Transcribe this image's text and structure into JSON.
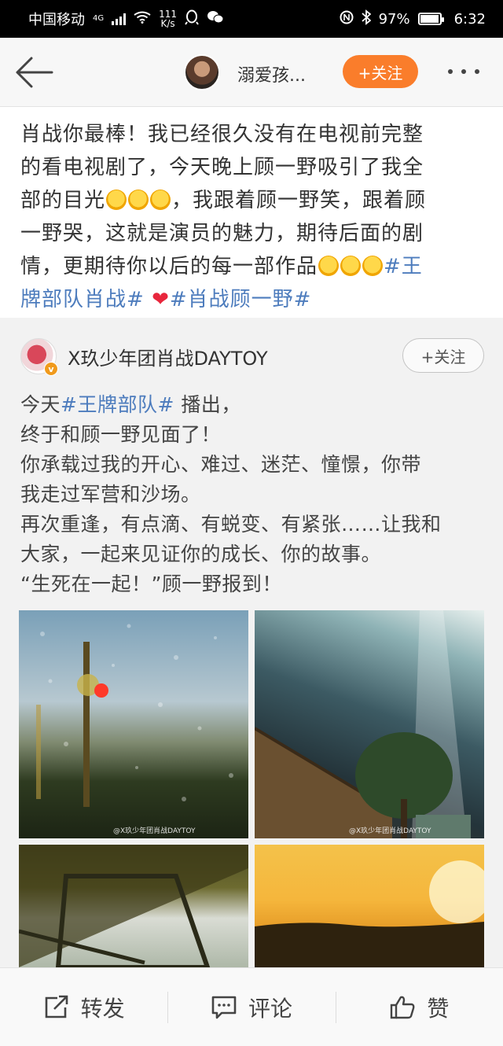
{
  "status_bar": {
    "carrier": "中国移动",
    "network": "4G",
    "speed_value": "111",
    "speed_unit": "K/s",
    "battery": "97%",
    "battery_level": 0.97,
    "time": "6:32"
  },
  "nav": {
    "username": "溺爱孩...",
    "follow_label": "+关注"
  },
  "comment": {
    "line1": "肖战你最棒！我已经很久没有在电视前完整",
    "line2": "的看电视剧了，今天晚上顾一野吸引了我全",
    "line3a": "部的目光",
    "line3b": "，我跟着顾一野笑，跟着顾",
    "line4": "一野哭，这就是演员的魅力，期待后面的剧",
    "line5": "情，更期待你以后的每一部作品",
    "topic1a": "#王",
    "topic1b": "牌部队肖战#",
    "heart": "❤",
    "topic2": "#肖战顾一野#"
  },
  "repost": {
    "author": "X玖少年团肖战DAYTOY",
    "verified_badge": "v",
    "follow_label": "+关注",
    "text_prefix": "今天",
    "topic": "#王牌部队#",
    "text_suffix": "播出，",
    "line2": "终于和顾一野见面了！",
    "line3": "你承载过我的开心、难过、迷茫、憧憬，你带",
    "line4": "我走过军营和沙场。",
    "line5": "再次重逢，有点滴、有蜕变、有紧张……让我和",
    "line6": "大家，一起来见证你的成长、你的故事。",
    "line7": "“生死在一起！”顾一野报到！",
    "watermark": "@X玖少年团肖战DAYTOY"
  },
  "actions": {
    "repost": "转发",
    "comment": "评论",
    "like": "赞"
  },
  "colors": {
    "accent": "#fa7d2b",
    "topic": "#4d7cbd"
  }
}
